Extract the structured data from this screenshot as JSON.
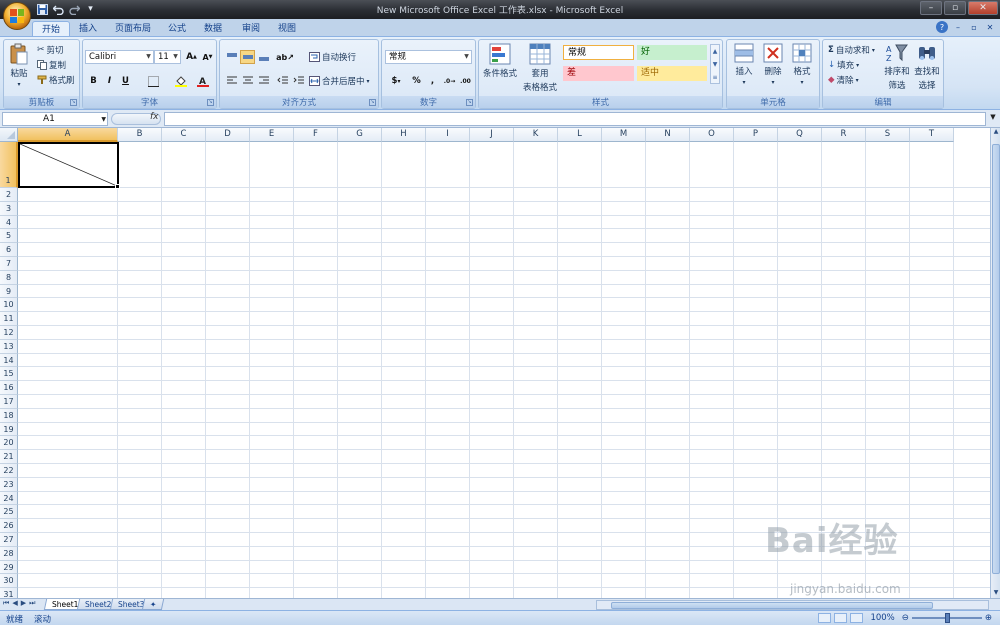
{
  "window": {
    "title": "New Microsoft Office Excel 工作表.xlsx - Microsoft Excel"
  },
  "qat": {
    "save_icon": "save-icon",
    "undo_icon": "undo-icon",
    "redo_icon": "redo-icon",
    "customize": "▾"
  },
  "tabs": [
    {
      "label": "开始",
      "active": true
    },
    {
      "label": "插入"
    },
    {
      "label": "页面布局"
    },
    {
      "label": "公式"
    },
    {
      "label": "数据"
    },
    {
      "label": "审阅"
    },
    {
      "label": "视图"
    }
  ],
  "clipboard": {
    "paste": "粘贴",
    "cut": "剪切",
    "copy": "复制",
    "format_painter": "格式刷",
    "group": "剪贴板"
  },
  "font": {
    "name": "Calibri",
    "size": "11",
    "group": "字体",
    "bold": "B",
    "italic": "I",
    "underline": "U"
  },
  "alignment": {
    "wrap": "自动换行",
    "merge": "合并后居中",
    "group": "对齐方式"
  },
  "number": {
    "format": "常规",
    "currency": "$",
    "percent": "%",
    "comma": ",",
    "group": "数字"
  },
  "styles": {
    "conditional": "条件格式",
    "table_line1": "套用",
    "table_line2": "表格格式",
    "normal": "常规",
    "good": "好",
    "bad": "差",
    "neutral": "适中",
    "group": "样式"
  },
  "cells": {
    "insert": "插入",
    "delete": "删除",
    "format": "格式",
    "group": "单元格"
  },
  "editing": {
    "autosum": "自动求和",
    "fill": "填充",
    "clear": "清除",
    "sort_line1": "排序和",
    "sort_line2": "筛选",
    "find_line1": "查找和",
    "find_line2": "选择",
    "group": "编辑"
  },
  "formula_bar": {
    "name_box": "A1",
    "fx": "fx",
    "content": ""
  },
  "columns": [
    "A",
    "B",
    "C",
    "D",
    "E",
    "F",
    "G",
    "H",
    "I",
    "J",
    "K",
    "L",
    "M",
    "N",
    "O",
    "P",
    "Q",
    "R",
    "S",
    "T"
  ],
  "rows": [
    "1",
    "2",
    "3",
    "4",
    "5",
    "6",
    "7",
    "8",
    "9",
    "10",
    "11",
    "12",
    "13",
    "14",
    "15",
    "16",
    "17",
    "18",
    "19",
    "20",
    "21",
    "22",
    "23",
    "24",
    "25",
    "26",
    "27",
    "28",
    "29",
    "30",
    "31"
  ],
  "selected_cell": {
    "column": "A",
    "row": "1",
    "diagonal_border": true
  },
  "sheets": [
    {
      "name": "Sheet1",
      "active": true
    },
    {
      "name": "Sheet2"
    },
    {
      "name": "Sheet3"
    }
  ],
  "status": {
    "ready": "就绪",
    "scroll": "滚动",
    "zoom": "100%"
  },
  "watermark": {
    "brand": "Bai经验",
    "url": "jingyan.baidu.com"
  },
  "colors": {
    "accent": "#15428b",
    "ribbon": "#dae7f6",
    "good": "#c6efce",
    "bad": "#ffc7ce",
    "neutral": "#ffeb9c",
    "selection": "#f1c15f"
  }
}
